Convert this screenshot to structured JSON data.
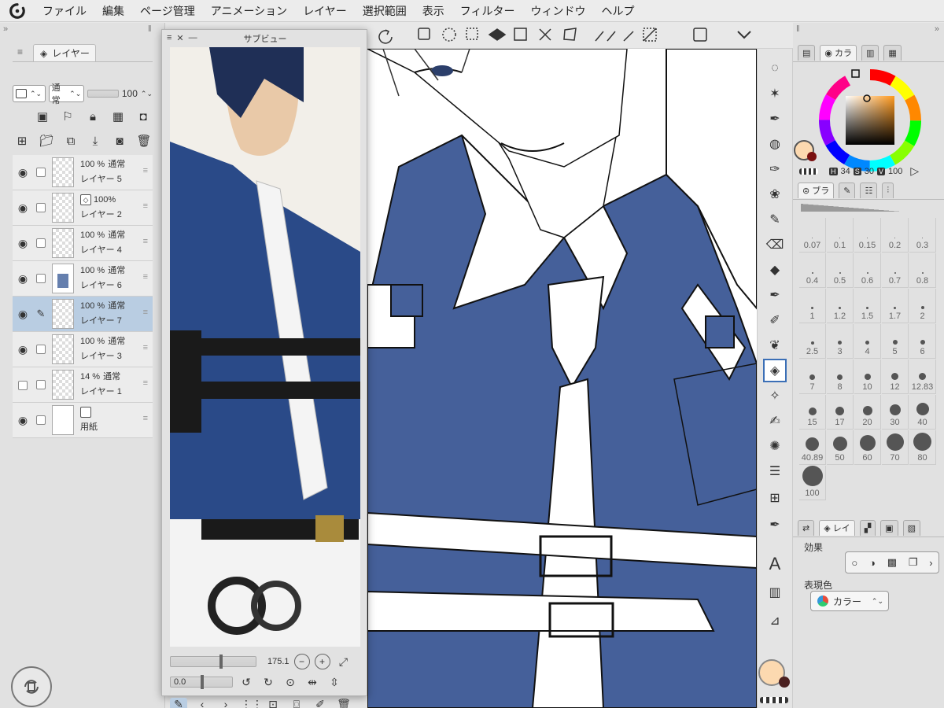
{
  "menubar": {
    "items": [
      "ファイル",
      "編集",
      "ページ管理",
      "アニメーション",
      "レイヤー",
      "選択範囲",
      "表示",
      "フィルター",
      "ウィンドウ",
      "ヘルプ"
    ]
  },
  "layer_panel": {
    "tab_label": "レイヤー",
    "blend_mode": "通常",
    "opacity": "100",
    "layers": [
      {
        "opacity": "100 %",
        "mode": "通常",
        "name": "レイヤー 5",
        "visible": true,
        "selected": false,
        "thumb": "empty"
      },
      {
        "opacity": "100%",
        "mode": "",
        "name": "レイヤー 2",
        "visible": true,
        "selected": false,
        "thumb": "sketch"
      },
      {
        "opacity": "100 %",
        "mode": "通常",
        "name": "レイヤー 4",
        "visible": true,
        "selected": false,
        "thumb": "empty"
      },
      {
        "opacity": "100 %",
        "mode": "通常",
        "name": "レイヤー 6",
        "visible": true,
        "selected": false,
        "thumb": "art"
      },
      {
        "opacity": "100 %",
        "mode": "通常",
        "name": "レイヤー 7",
        "visible": true,
        "selected": true,
        "thumb": "empty"
      },
      {
        "opacity": "100 %",
        "mode": "通常",
        "name": "レイヤー 3",
        "visible": true,
        "selected": false,
        "thumb": "empty"
      },
      {
        "opacity": "14 %",
        "mode": "通常",
        "name": "レイヤー 1",
        "visible": false,
        "selected": false,
        "thumb": "sketch"
      },
      {
        "opacity": "",
        "mode": "",
        "name": "用紙",
        "visible": true,
        "selected": false,
        "thumb": "paper"
      }
    ]
  },
  "subview": {
    "title": "サブビュー",
    "zoom": "175.1",
    "rotation": "0.0"
  },
  "color_panel": {
    "tab_label": "カラ",
    "h_value": "34",
    "s_value": "30",
    "v_value": "100",
    "h_label": "H",
    "s_label": "S",
    "v_label": "V",
    "main_color": "#fcd9b0",
    "blue": "#45609a"
  },
  "brush_panel": {
    "tab_label": "ブラ",
    "sizes": [
      "0.07",
      "0.1",
      "0.15",
      "0.2",
      "0.3",
      "0.4",
      "0.5",
      "0.6",
      "0.7",
      "0.8",
      "1",
      "1.2",
      "1.5",
      "1.7",
      "2",
      "2.5",
      "3",
      "4",
      "5",
      "6",
      "7",
      "8",
      "10",
      "12",
      "12.83",
      "15",
      "17",
      "20",
      "30",
      "40",
      "40.89",
      "50",
      "60",
      "70",
      "80",
      "100"
    ]
  },
  "property_panel": {
    "tab_label": "レイ",
    "effect_label": "効果",
    "expression_label": "表現色",
    "expression_value": "カラー"
  }
}
